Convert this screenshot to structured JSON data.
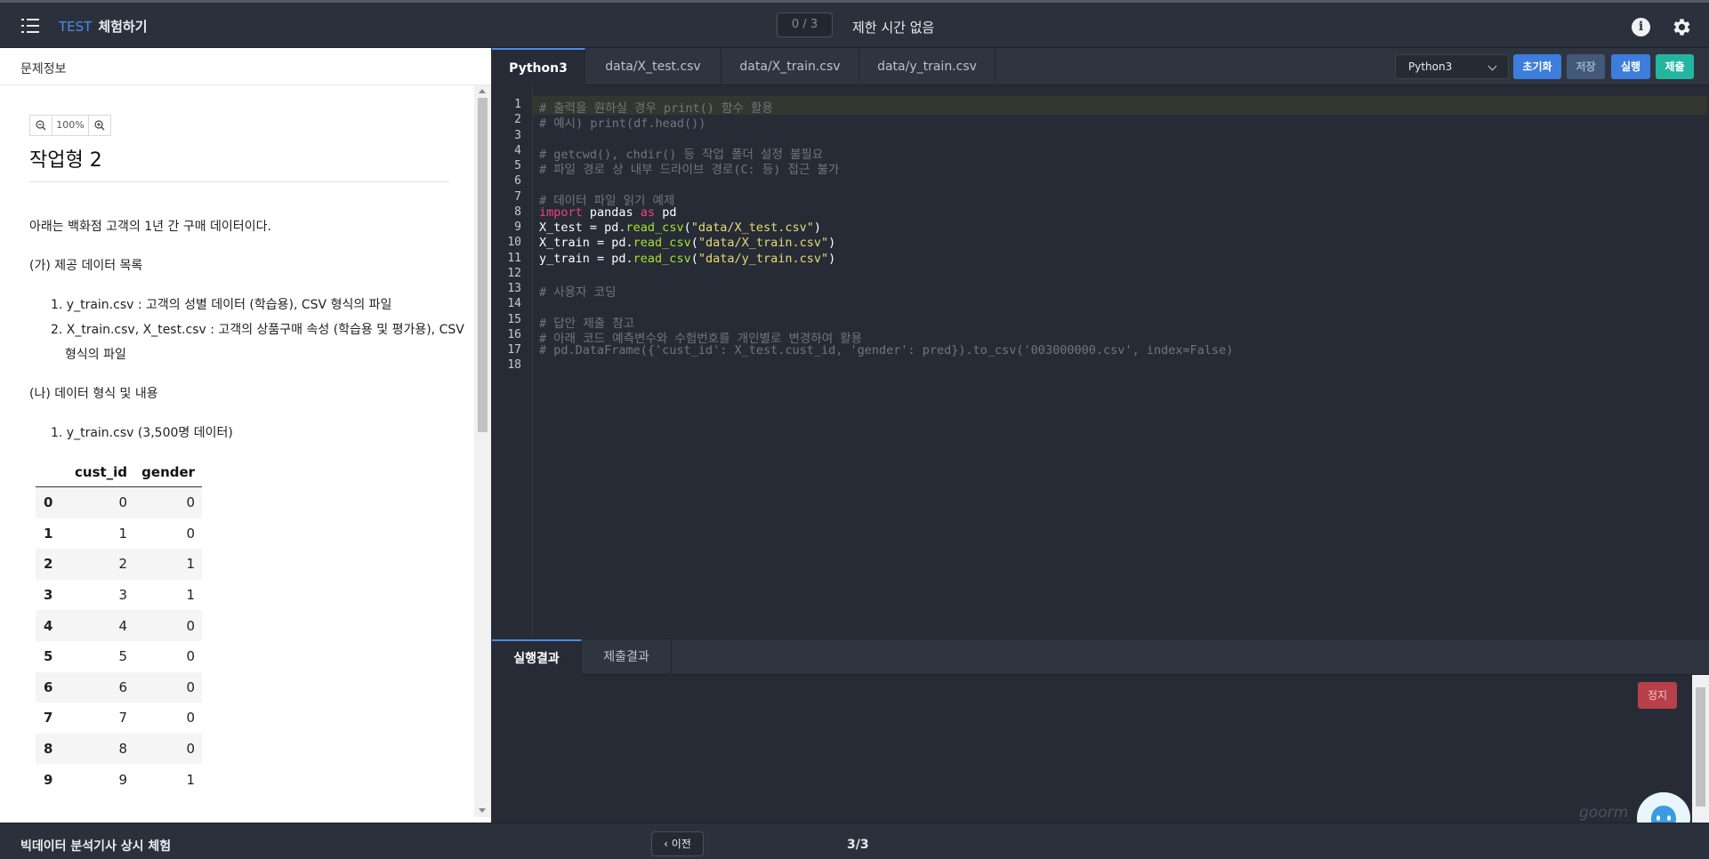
{
  "header": {
    "brand": "TEST",
    "title": "체험하기",
    "progress": "0 / 3",
    "time_limit": "제한 시간 없음"
  },
  "left_panel": {
    "header": "문제정보",
    "zoom": "100%",
    "title": "작업형 2",
    "intro": "아래는 백화점 고객의 1년 간 구매 데이터이다.",
    "section_a": "(가) 제공 데이터 목록",
    "list_a": [
      "1. y_train.csv : 고객의 성별 데이터 (학습용), CSV 형식의 파일",
      "2. X_train.csv, X_test.csv : 고객의 상품구매 속성 (학습용 및 평가용), CSV",
      "형식의 파일"
    ],
    "section_b": "(나) 데이터 형식 및 내용",
    "list_b": [
      "1. y_train.csv (3,500명 데이터)"
    ],
    "table": {
      "columns": [
        "cust_id",
        "gender"
      ],
      "rows": [
        [
          "0",
          "0",
          "0"
        ],
        [
          "1",
          "1",
          "0"
        ],
        [
          "2",
          "2",
          "1"
        ],
        [
          "3",
          "3",
          "1"
        ],
        [
          "4",
          "4",
          "0"
        ],
        [
          "5",
          "5",
          "0"
        ],
        [
          "6",
          "6",
          "0"
        ],
        [
          "7",
          "7",
          "0"
        ],
        [
          "8",
          "8",
          "0"
        ],
        [
          "9",
          "9",
          "1"
        ]
      ]
    }
  },
  "editor": {
    "tabs": [
      "Python3",
      "data/X_test.csv",
      "data/X_train.csv",
      "data/y_train.csv"
    ],
    "language": "Python3",
    "buttons": {
      "reset": "초기화",
      "save": "저장",
      "run": "실행",
      "submit": "제출"
    },
    "lines": [
      "# 출력을 원하실 경우 print() 함수 활용",
      "# 예시) print(df.head())",
      "",
      "# getcwd(), chdir() 등 작업 폴더 설정 불필요",
      "# 파일 경로 상 내부 드라이브 경로(C: 등) 접근 불가",
      "",
      "# 데이터 파일 읽기 예제",
      "import pandas as pd",
      "X_test = pd.read_csv(\"data/X_test.csv\")",
      "X_train = pd.read_csv(\"data/X_train.csv\")",
      "y_train = pd.read_csv(\"data/y_train.csv\")",
      "",
      "# 사용자 코딩",
      "",
      "# 답안 제출 참고",
      "# 아래 코드 예측변수와 수험번호를 개인별로 변경하여 활용",
      "# pd.DataFrame({'cust_id': X_test.cust_id, 'gender': pred}).to_csv('003000000.csv', index=False)",
      ""
    ]
  },
  "results": {
    "tabs": [
      "실행결과",
      "제출결과"
    ],
    "stop": "정지",
    "watermark": "goorm"
  },
  "footer": {
    "title": "빅데이터 분석기사 상시 체험",
    "prev": "이전",
    "page": "3/3"
  },
  "colors": {
    "accent": "#4b8de8",
    "run": "#3d7ddb",
    "submit": "#23b5a0",
    "stop": "#b8404a"
  }
}
